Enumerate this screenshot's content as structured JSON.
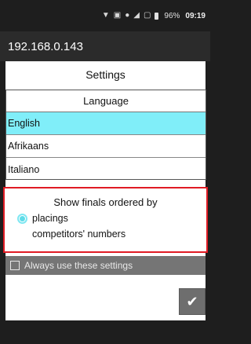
{
  "status_bar": {
    "battery_text": "96%",
    "time": "09:19",
    "icons": [
      "wifi-signal-icon",
      "image-icon",
      "do-not-disturb-icon",
      "signal-icon",
      "no-sim-icon",
      "battery-icon"
    ]
  },
  "app_bar": {
    "title": "192.168.0.143"
  },
  "dialog": {
    "title": "Settings",
    "language": {
      "header": "Language",
      "options": [
        "English",
        "Afrikaans",
        "Italiano"
      ],
      "selected": "English"
    },
    "finals": {
      "title": "Show finals ordered by",
      "options": [
        "placings",
        "competitors' numbers"
      ],
      "selected": "placings"
    },
    "always_use": {
      "label": "Always use these settings",
      "checked": false
    },
    "ok_icon": "checkmark-icon"
  },
  "colors": {
    "selection": "#80eef9",
    "highlight_border": "#e01b24",
    "radio_accent": "#5fdbe8"
  }
}
